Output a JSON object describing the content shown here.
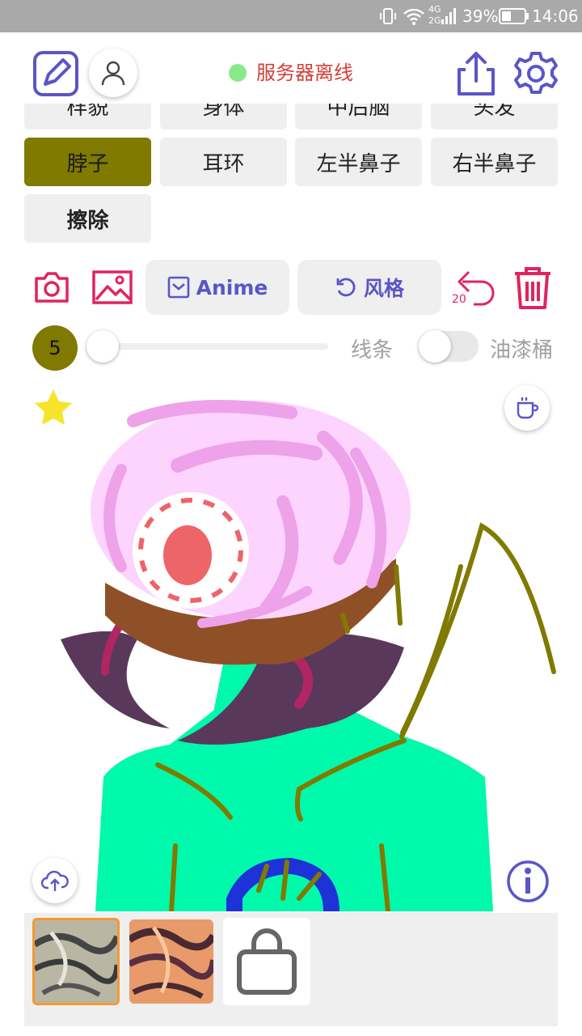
{
  "status_bar": {
    "network_label_top": "4G",
    "network_label_bottom": "2G",
    "battery_percent": "39%",
    "time": "14:06"
  },
  "header": {
    "server_status_text": "服务器离线",
    "server_status_color": "#8be98b"
  },
  "parts": {
    "partial_row": [
      "样貌",
      "身体",
      "中后脑",
      "头发"
    ],
    "row1": [
      "脖子",
      "耳环",
      "左半鼻子",
      "右半鼻子"
    ],
    "row2": [
      "擦除"
    ],
    "selected": "脖子"
  },
  "toolbar": {
    "anime_label": "Anime",
    "style_label": "风格",
    "undo_count": "20"
  },
  "brush": {
    "size": "5",
    "line_label": "线条",
    "bucket_label": "油漆桶",
    "slider_value": 0,
    "toggle_on": false
  },
  "colors": {
    "accent": "#5b55c8",
    "red_icon": "#e0245e",
    "selected": "#807a00",
    "star": "#f6e42a"
  },
  "icons": {
    "edit": "edit-icon",
    "user": "user-icon",
    "share": "share-icon",
    "settings": "gear-icon",
    "camera": "camera-icon",
    "gallery": "image-icon",
    "undo": "undo-icon",
    "trash": "trash-icon",
    "star": "star-icon",
    "coffee": "coffee-icon",
    "upload": "cloud-upload-icon",
    "info": "info-icon",
    "bag": "shopping-bag-icon"
  }
}
